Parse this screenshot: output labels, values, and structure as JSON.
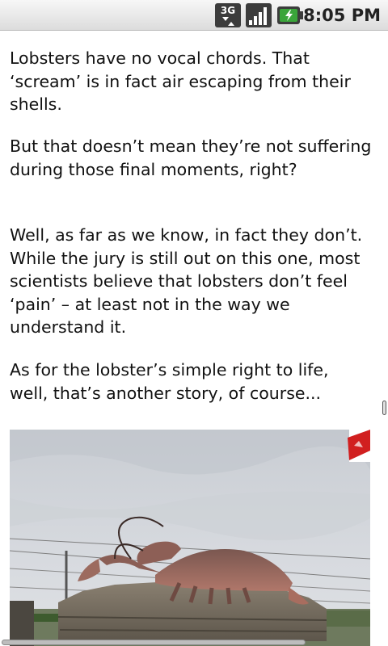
{
  "status_bar": {
    "network_label": "3G",
    "time": "8:05 PM",
    "icons": [
      "network-3g-icon",
      "signal-strength-icon",
      "battery-charging-icon"
    ]
  },
  "article": {
    "paragraphs": [
      "Lobsters have no vocal chords. That ‘scream’ is in fact air escaping from their shells.",
      "But that doesn’t mean they’re not suffering during those final moments, right?",
      "Well, as far as we know, in fact they don’t. While the jury is still out on this one, most scientists believe that lobsters don’t feel ‘pain’ – at least not in the way we understand it.",
      "As for the lobster’s simple right to life, well, that’s another story, of course..."
    ],
    "image_icon": "lobster-statue-photo"
  },
  "colors": {
    "text": "#111111",
    "status_bar_top": "#f7f7f7",
    "status_bar_bottom": "#dcdcdc",
    "battery_green": "#3aa53a",
    "flag_red": "#d11f1f"
  }
}
